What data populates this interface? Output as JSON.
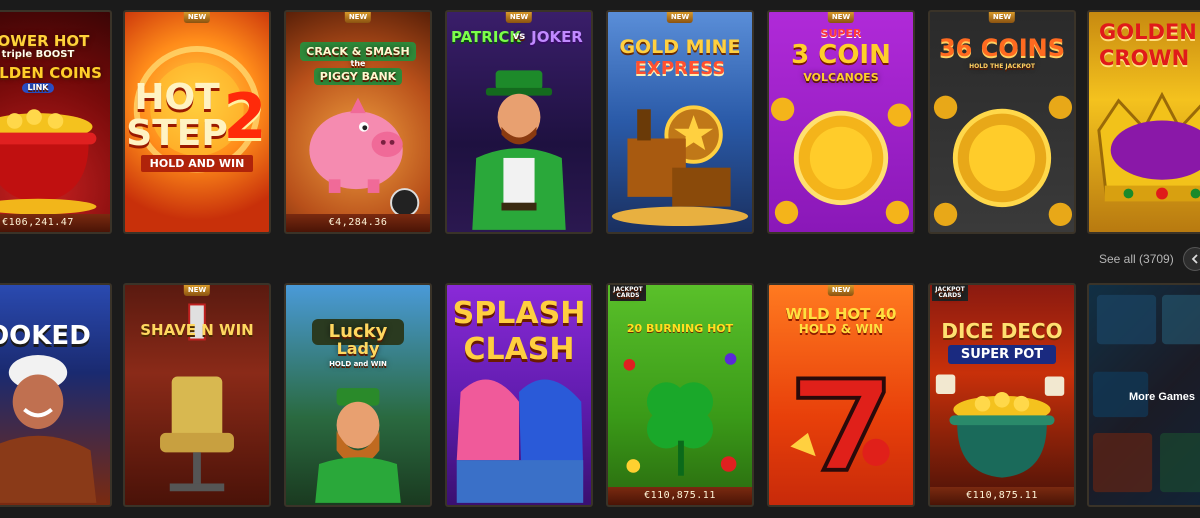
{
  "row1": {
    "tiles": [
      {
        "name": "power-hot-golden-coins",
        "title_lines": [
          "POWER HOT",
          "triple BOOST",
          "GOLDEN COINS",
          "LINK"
        ],
        "jackpot": "€106,241.47",
        "new": false
      },
      {
        "name": "hot-step-2",
        "title_lines": [
          "HOT",
          "STEP",
          "2",
          "HOLD AND WIN"
        ],
        "jackpot": "",
        "new": true
      },
      {
        "name": "crack-smash-piggy-bank",
        "title_lines": [
          "CRACK & SMASH",
          "the",
          "PIGGY BANK"
        ],
        "jackpot": "€4,284.36",
        "new": true
      },
      {
        "name": "patrick-vs-joker",
        "title_lines": [
          "PATRICK",
          "vs",
          "JOKER"
        ],
        "jackpot": "",
        "new": true
      },
      {
        "name": "gold-mine-express",
        "title_lines": [
          "GOLD MINE",
          "EXPRESS"
        ],
        "jackpot": "",
        "new": true
      },
      {
        "name": "super-3-coin-volcanoes",
        "title_lines": [
          "SUPER",
          "3 COIN",
          "VOLCANOES"
        ],
        "jackpot": "",
        "new": true
      },
      {
        "name": "36-coins",
        "title_lines": [
          "36 COINS",
          "HOLD THE JACKPOT"
        ],
        "jackpot": "",
        "new": true
      },
      {
        "name": "golden-crown",
        "title_lines": [
          "GOLDEN",
          "CROWN"
        ],
        "jackpot": "",
        "new": false
      }
    ]
  },
  "see_all": "See all (3709)",
  "row2": {
    "tiles": [
      {
        "name": "cooked",
        "title_lines": [
          "COOKED"
        ],
        "jackpot": "",
        "new": false
      },
      {
        "name": "shave-n-win",
        "title_lines": [
          "SHAVE N WIN"
        ],
        "jackpot": "",
        "new": true
      },
      {
        "name": "lucky-lady",
        "title_lines": [
          "Lucky",
          "Lady",
          "HOLD and WIN"
        ],
        "jackpot": "",
        "new": false
      },
      {
        "name": "splash-clash",
        "title_lines": [
          "SPLASH",
          "CLASH"
        ],
        "jackpot": "",
        "new": false
      },
      {
        "name": "20-burning-hot",
        "title_lines": [
          "JACKPOT CARDS",
          "20 BURNING HOT"
        ],
        "jackpot": "€110,875.11",
        "new": false
      },
      {
        "name": "wild-hot-40",
        "title_lines": [
          "WILD HOT 40",
          "HOLD & WIN"
        ],
        "jackpot": "",
        "new": true
      },
      {
        "name": "dice-deco-super-pot",
        "title_lines": [
          "JACKPOT CARDS",
          "DICE DECO",
          "SUPER POT"
        ],
        "jackpot": "€110,875.11",
        "new": false
      }
    ],
    "more_label": "More Games"
  },
  "badges": {
    "new": "NEW"
  },
  "colors": {
    "background": "#1b1b1b",
    "tile_border": "#3a3328",
    "jackpot_bar": "#6a220c",
    "badge": "#c7871e"
  }
}
